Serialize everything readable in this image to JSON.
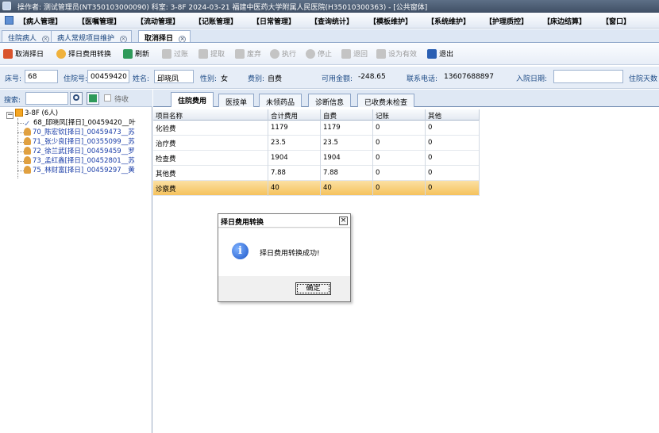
{
  "window": {
    "title": "操作者: 测试管理员(NT350103000090)  科室: 3-8F  2024-03-21  福建中医药大学附属人民医院(H35010300363) - [公共窗体]"
  },
  "menu": [
    "【病人管理】",
    "【医嘱管理】",
    "【流动管理】",
    "【记账管理】",
    "【日常管理】",
    "【查询统计】",
    "【模板维护】",
    "【系统维护】",
    "【护理质控】",
    "【床边结算】",
    "【窗口】"
  ],
  "doc_tabs": [
    {
      "label": "住院病人"
    },
    {
      "label": "病人常规项目维护"
    },
    {
      "label": "取消择日"
    }
  ],
  "toolbar": [
    {
      "label": "取消择日",
      "icon": "cancel-icon"
    },
    {
      "label": "择日费用转换",
      "icon": "convert-icon"
    },
    {
      "label": "刷新",
      "icon": "refresh-icon"
    },
    {
      "label": "过账",
      "icon": "post-icon"
    },
    {
      "label": "提取",
      "icon": "extract-icon"
    },
    {
      "label": "废弃",
      "icon": "trash-icon"
    },
    {
      "label": "执行",
      "icon": "execute-icon"
    },
    {
      "label": "停止",
      "icon": "stop-icon"
    },
    {
      "label": "退回",
      "icon": "return-icon"
    },
    {
      "label": "设为有效",
      "icon": "valid-icon"
    },
    {
      "label": "退出",
      "icon": "exit-icon"
    }
  ],
  "patient": {
    "bed_label": "床号:",
    "bed_value": "68",
    "inpatient_no_label": "住院号:",
    "inpatient_no_value": "00459420",
    "name_label": "姓名:",
    "name_value": "邱晓凤",
    "gender_label": "性别:",
    "gender_value": "女",
    "fee_type_label": "费别:",
    "fee_type_value": "自费",
    "balance_label": "可用金额:",
    "balance_value": "-248.65",
    "phone_label": "联系电话:",
    "phone_value": "13607688897",
    "admit_date_label": "入院日期:",
    "admit_date_value": "",
    "days_label": "住院天数"
  },
  "search": {
    "label": "搜索:",
    "value": "",
    "pending_label": "待收"
  },
  "tree": {
    "root": "3-8F (6人)",
    "patients": [
      "68_邱晓凤[择日]_00459420__叶",
      "70_陈宏钦[择日]_00459473__苏",
      "71_张少良[择日]_00355099__苏",
      "72_徐兰武[择日]_00459459__罗",
      "73_孟红鑫[择日]_00452801__苏",
      "75_林财富[择日]_00459297__黄"
    ]
  },
  "detail_tabs": [
    "住院费用",
    "医技单",
    "未领药品",
    "诊断信息",
    "已收费未检查"
  ],
  "fee_table": {
    "columns": [
      "项目名称",
      "合计费用",
      "自费",
      "记账",
      "其他"
    ],
    "rows": [
      [
        "化验费",
        "1179",
        "1179",
        "0",
        "0"
      ],
      [
        "治疗费",
        "23.5",
        "23.5",
        "0",
        "0"
      ],
      [
        "检查费",
        "1904",
        "1904",
        "0",
        "0"
      ],
      [
        "其他费",
        "7.88",
        "7.88",
        "0",
        "0"
      ],
      [
        "诊察费",
        "40",
        "40",
        "0",
        "0"
      ]
    ]
  },
  "dialog": {
    "title": "择日费用转换",
    "message": "择日费用转换成功!",
    "ok_label": "确定",
    "close_label": "×"
  },
  "colors": {
    "accent": "#1d4b86",
    "selected_row": "#f5c25d"
  }
}
